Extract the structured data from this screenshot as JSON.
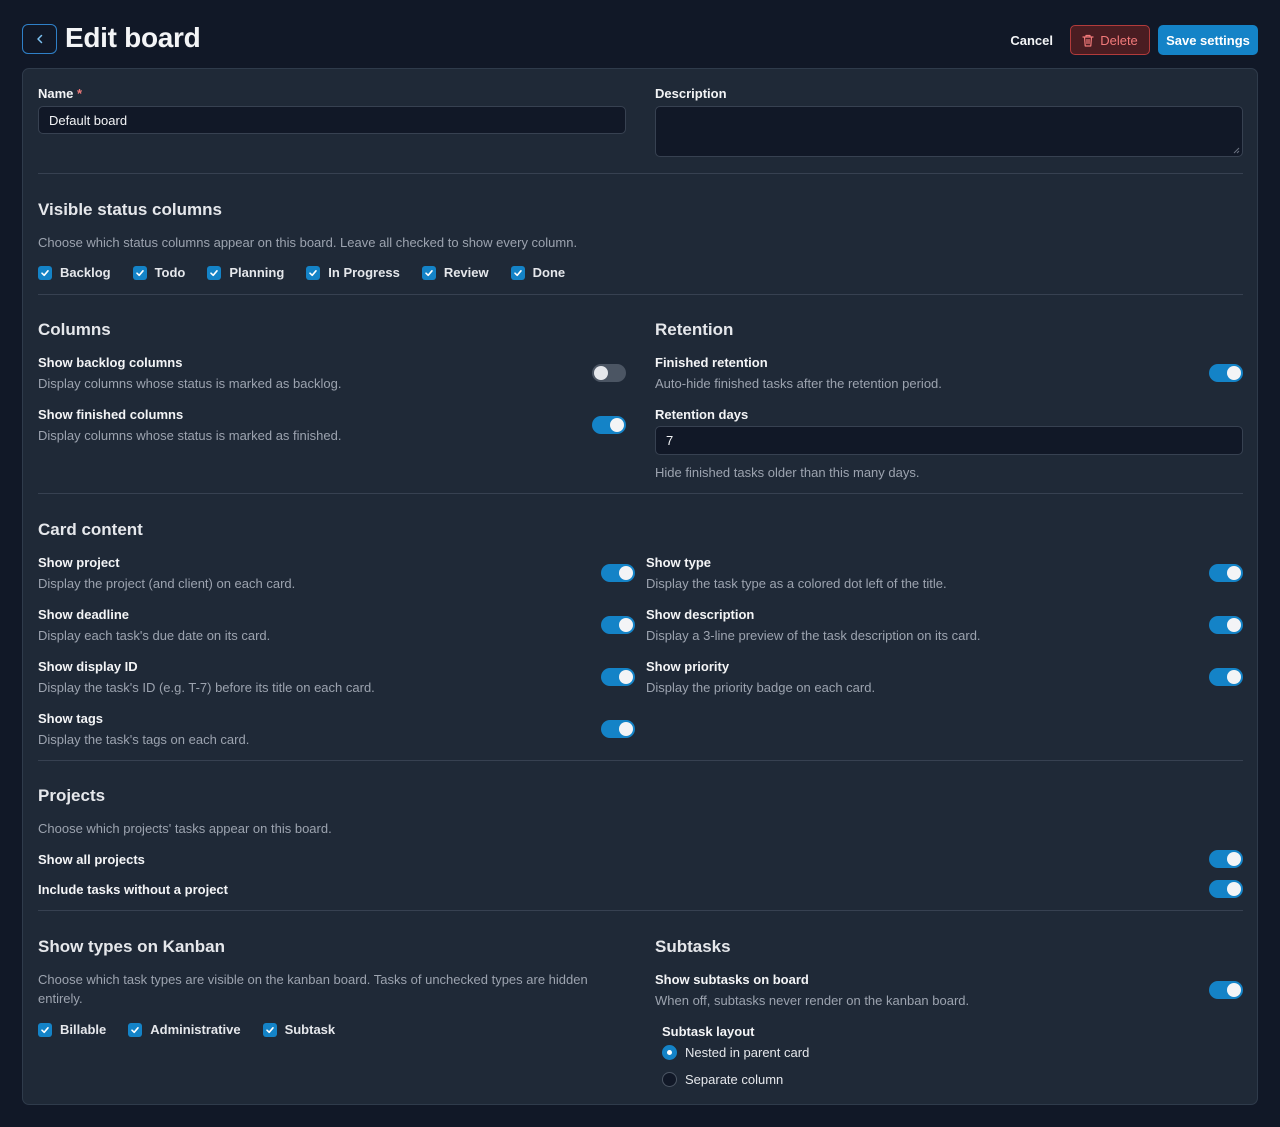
{
  "header": {
    "title": "Edit board",
    "cancel_label": "Cancel",
    "delete_label": "Delete",
    "save_label": "Save settings"
  },
  "form": {
    "name_label": "Name",
    "required_mark": "*",
    "name_value": "Default board",
    "description_label": "Description",
    "description_value": ""
  },
  "status_columns": {
    "title": "Visible status columns",
    "help": "Choose which status columns appear on this board. Leave all checked to show every column.",
    "items": [
      {
        "label": "Backlog",
        "checked": true
      },
      {
        "label": "Todo",
        "checked": true
      },
      {
        "label": "Planning",
        "checked": true
      },
      {
        "label": "In Progress",
        "checked": true
      },
      {
        "label": "Review",
        "checked": true
      },
      {
        "label": "Done",
        "checked": true
      }
    ]
  },
  "columns": {
    "title": "Columns",
    "show_backlog": {
      "label": "Show backlog columns",
      "desc": "Display columns whose status is marked as backlog.",
      "on": false
    },
    "show_finished": {
      "label": "Show finished columns",
      "desc": "Display columns whose status is marked as finished.",
      "on": true
    }
  },
  "retention": {
    "title": "Retention",
    "finished": {
      "label": "Finished retention",
      "desc": "Auto-hide finished tasks after the retention period.",
      "on": true
    },
    "days_label": "Retention days",
    "days_value": "7",
    "days_help": "Hide finished tasks older than this many days."
  },
  "card_content": {
    "title": "Card content",
    "left": [
      {
        "label": "Show project",
        "desc": "Display the project (and client) on each card.",
        "on": true
      },
      {
        "label": "Show deadline",
        "desc": "Display each task's due date on its card.",
        "on": true
      },
      {
        "label": "Show display ID",
        "desc": "Display the task's ID (e.g. T-7) before its title on each card.",
        "on": true
      },
      {
        "label": "Show tags",
        "desc": "Display the task's tags on each card.",
        "on": true
      }
    ],
    "right": [
      {
        "label": "Show type",
        "desc": "Display the task type as a colored dot left of the title.",
        "on": true
      },
      {
        "label": "Show description",
        "desc": "Display a 3-line preview of the task description on its card.",
        "on": true
      },
      {
        "label": "Show priority",
        "desc": "Display the priority badge on each card.",
        "on": true
      }
    ]
  },
  "projects": {
    "title": "Projects",
    "help": "Choose which projects' tasks appear on this board.",
    "show_all": {
      "label": "Show all projects",
      "on": true
    },
    "include_none": {
      "label": "Include tasks without a project",
      "on": true
    }
  },
  "types": {
    "title": "Show types on Kanban",
    "help_line1": "Choose which task types are visible on the kanban board. Tasks of unchecked types are hidden",
    "help_line2": "entirely.",
    "items": [
      {
        "label": "Billable",
        "checked": true
      },
      {
        "label": "Administrative",
        "checked": true
      },
      {
        "label": "Subtask",
        "checked": true
      }
    ]
  },
  "subtasks": {
    "title": "Subtasks",
    "show": {
      "label": "Show subtasks on board",
      "desc": "When off, subtasks never render on the kanban board.",
      "on": true
    },
    "layout_label": "Subtask layout",
    "options": [
      {
        "label": "Nested in parent card",
        "selected": true
      },
      {
        "label": "Separate column",
        "selected": false
      }
    ]
  },
  "colors": {
    "background": "#111827",
    "card": "#1f2937",
    "accent": "#1483c7",
    "danger": "#f27a7a"
  }
}
